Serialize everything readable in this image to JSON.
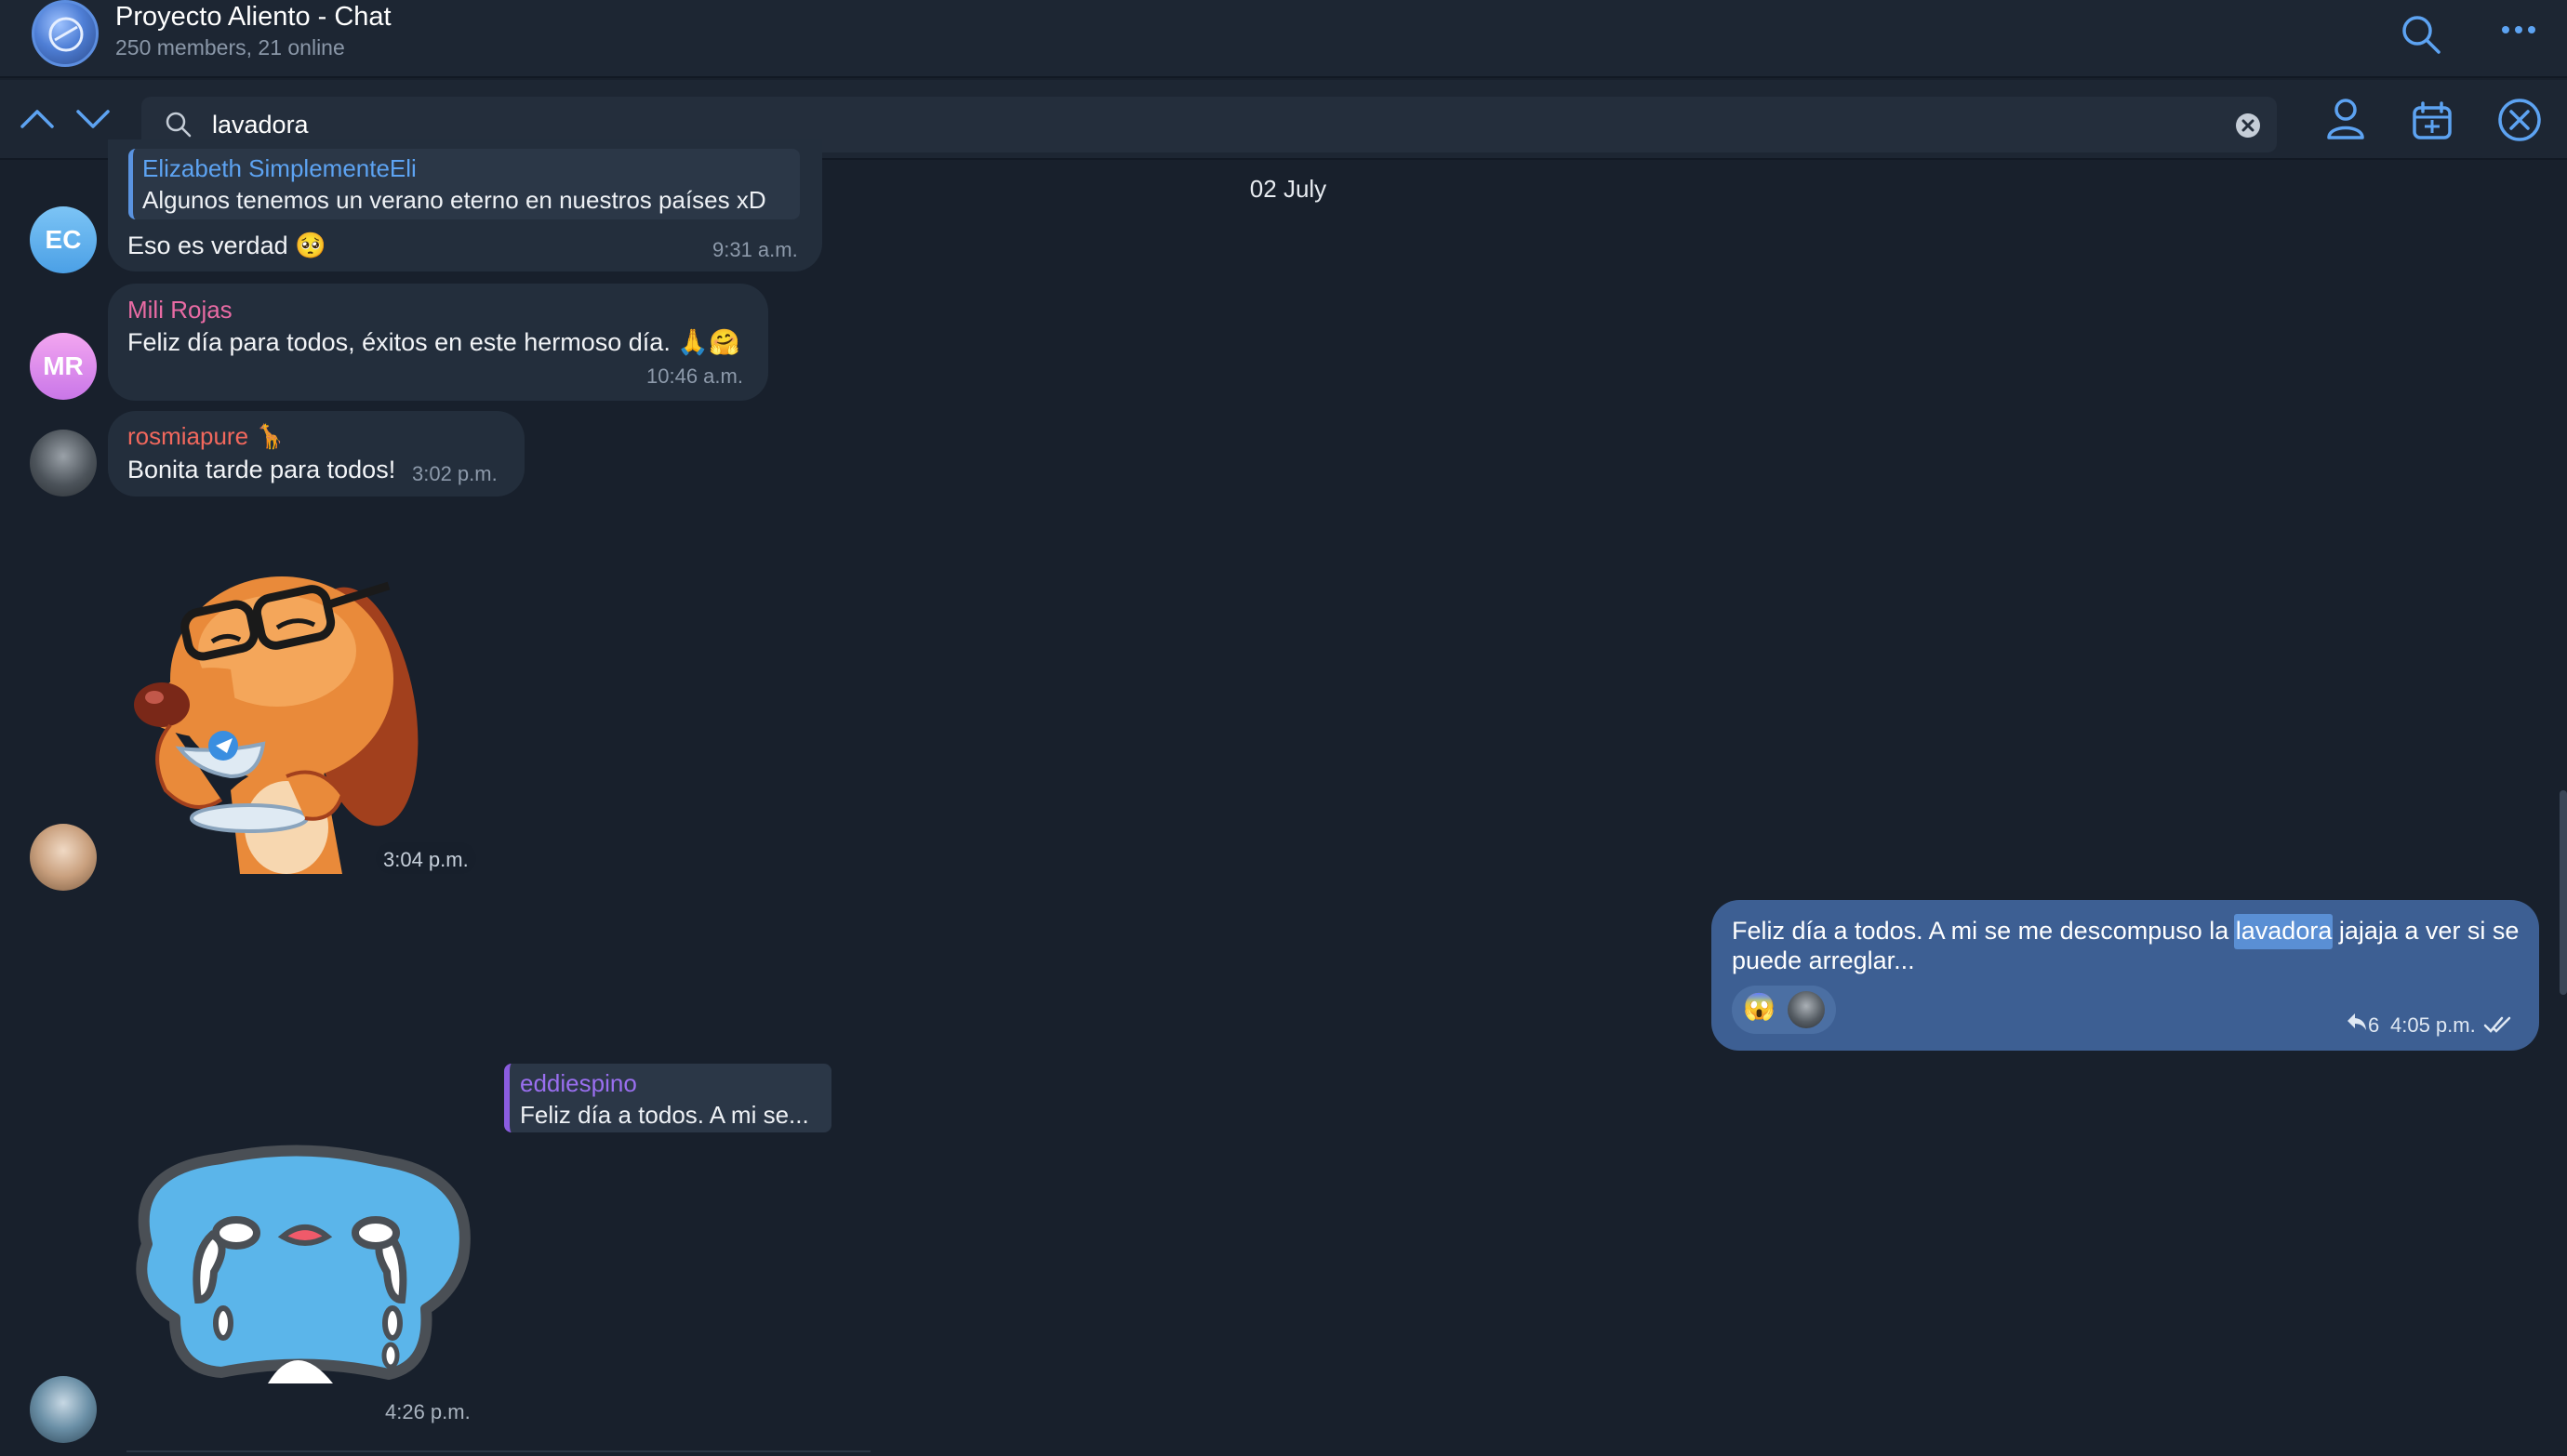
{
  "header": {
    "title": "Proyecto Aliento - Chat",
    "subtitle": "250 members, 21 online",
    "icons": [
      "search-icon",
      "more-icon"
    ]
  },
  "search": {
    "query": "lavadora",
    "icons": [
      "chevron-up-icon",
      "chevron-down-icon",
      "search-icon",
      "clear-icon",
      "user-icon",
      "calendar-icon",
      "close-icon"
    ]
  },
  "date_separator": "02 July",
  "messages": [
    {
      "avatar_initials": "EC",
      "reply": {
        "name": "Elizabeth SimplementeEli",
        "text": "Algunos tenemos un verano eterno en nuestros países xD"
      },
      "text": "Eso es verdad 🥺",
      "time": "9:31 a.m."
    },
    {
      "avatar_initials": "MR",
      "sender": "Mili Rojas",
      "text": "Feliz día para todos, éxitos en este hermoso día. 🙏🤗",
      "time": "10:46 a.m."
    },
    {
      "sender": "rosmiapure 🦒",
      "text": "Bonita tarde para todos!",
      "time": "3:02 p.m."
    },
    {
      "sticker": "dog-drinking-tea-sticker",
      "time": "3:04 p.m."
    },
    {
      "outgoing": true,
      "text_before": "Feliz día a todos. A mi se me descompuso la ",
      "highlight": "lavadora",
      "text_after": " jajaja a ver si se",
      "text_line2": "puede arreglar...",
      "reaction_emoji": "😱",
      "reply_count": "6",
      "time": "4:05 p.m."
    },
    {
      "reply": {
        "name": "eddiespino",
        "text": "Feliz día a todos. A mi se..."
      },
      "sticker": "crying-blob-sticker",
      "time": "4:26 p.m."
    }
  ],
  "colors": {
    "background": "#18202c",
    "incoming_bubble": "#232e3c",
    "outgoing_bubble": "#3d5f93",
    "accent": "#5da3f2"
  }
}
